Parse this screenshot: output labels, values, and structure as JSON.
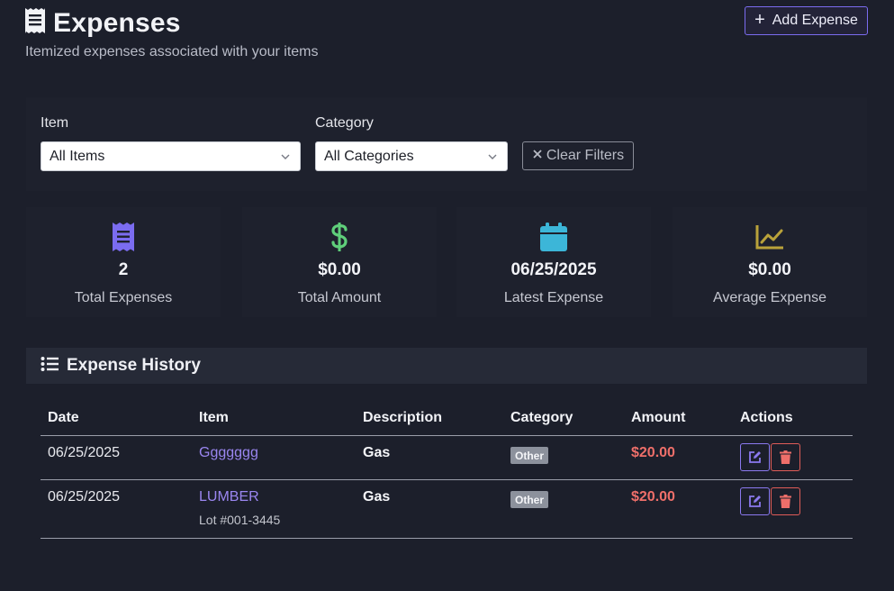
{
  "header": {
    "title": "Expenses",
    "subtitle": "Itemized expenses associated with your items",
    "icon": "receipt-icon",
    "add_button_label": "Add Expense"
  },
  "filters": {
    "item_label": "Item",
    "item_selected": "All Items",
    "category_label": "Category",
    "category_selected": "All Categories",
    "clear_label": "Clear Filters"
  },
  "stats": [
    {
      "icon": "receipt-icon",
      "color": "#7b6cf0",
      "value": "2",
      "label": "Total Expenses"
    },
    {
      "icon": "dollar-icon",
      "color": "#5fcf7a",
      "value": "$0.00",
      "label": "Total Amount"
    },
    {
      "icon": "calendar-icon",
      "color": "#3cb6d8",
      "value": "06/25/2025",
      "label": "Latest Expense"
    },
    {
      "icon": "chart-line-icon",
      "color": "#b9a23a",
      "value": "$0.00",
      "label": "Average Expense"
    }
  ],
  "history": {
    "title": "Expense History",
    "columns": [
      "Date",
      "Item",
      "Description",
      "Category",
      "Amount",
      "Actions"
    ],
    "rows": [
      {
        "date": "06/25/2025",
        "item": "Ggggggg",
        "sub": "",
        "description": "Gas",
        "category": "Other",
        "amount": "$20.00"
      },
      {
        "date": "06/25/2025",
        "item": "LUMBER",
        "sub": "Lot #001-3445",
        "description": "Gas",
        "category": "Other",
        "amount": "$20.00"
      }
    ]
  },
  "colors": {
    "accent": "#7b6cf0",
    "danger": "#ef6f6a",
    "background": "#1c1f2b"
  }
}
